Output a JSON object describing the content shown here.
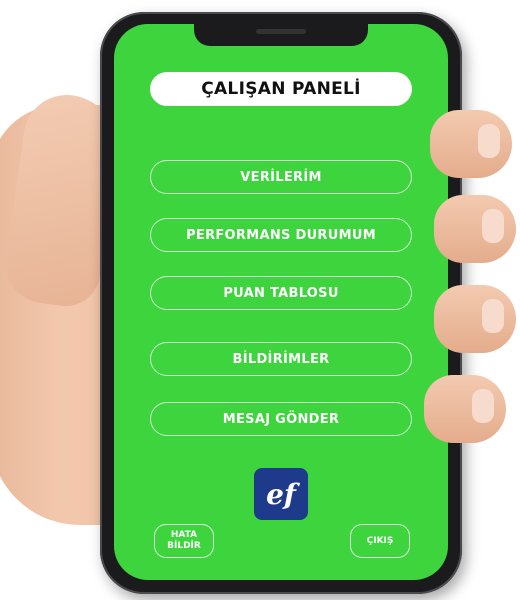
{
  "panel": {
    "title": "ÇALIŞAN PANELİ"
  },
  "menu": {
    "items": [
      {
        "label": "VERİLERİM"
      },
      {
        "label": "PERFORMANS DURUMUM"
      },
      {
        "label": "PUAN TABLOSU"
      },
      {
        "label": "BİLDİRİMLER"
      },
      {
        "label": "MESAJ GÖNDER"
      }
    ]
  },
  "footer": {
    "report_label": "HATA BİLDİR",
    "exit_label": "ÇIKIŞ"
  },
  "colors": {
    "screen": "#3dd43d",
    "logo": "#1e3a8a"
  },
  "icons": {
    "logo": "ef-logo"
  }
}
